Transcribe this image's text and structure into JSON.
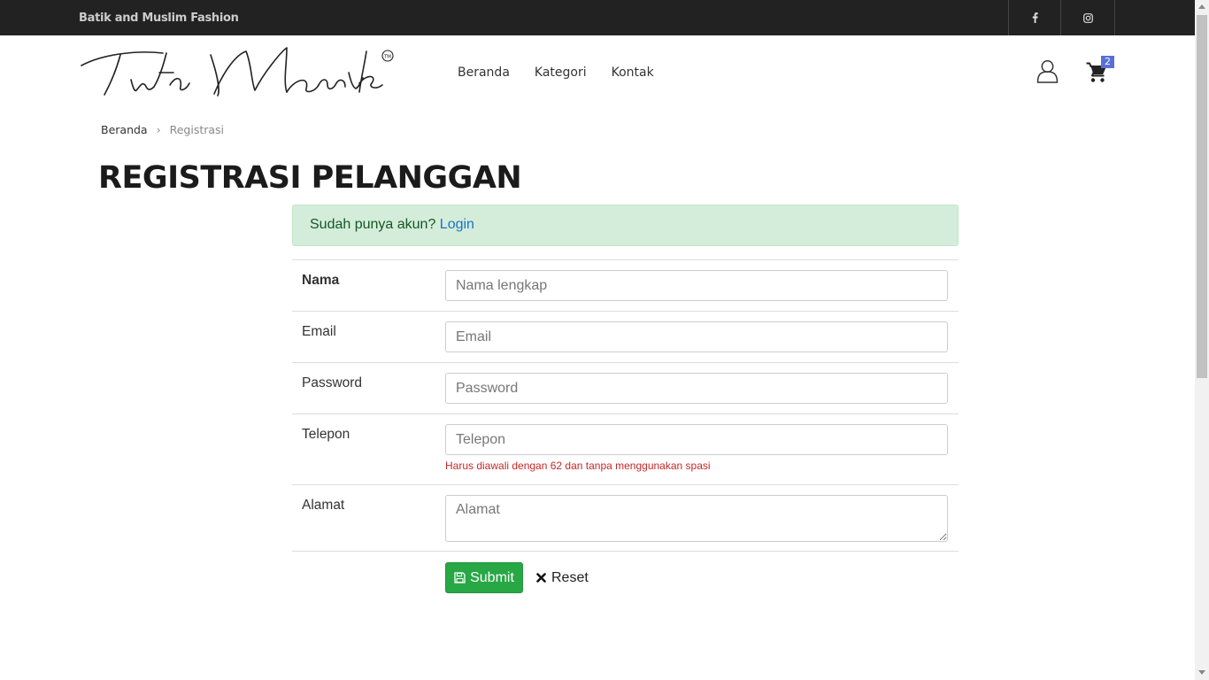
{
  "topbar": {
    "tagline": "Batik and Muslim Fashion"
  },
  "social": {
    "facebook_icon": "facebook-icon",
    "instagram_icon": "instagram-icon"
  },
  "header": {
    "logo_text": "Tirta Manik",
    "logo_mark": "TM",
    "nav": [
      "Beranda",
      "Kategori",
      "Kontak"
    ],
    "cart_count": "2"
  },
  "breadcrumb": {
    "home": "Beranda",
    "current": "Registrasi"
  },
  "page": {
    "title": "REGISTRASI PELANGGAN"
  },
  "alert": {
    "text": "Sudah punya akun? ",
    "link": "Login"
  },
  "form": {
    "nama": {
      "label": "Nama",
      "placeholder": "Nama lengkap"
    },
    "email": {
      "label": "Email",
      "placeholder": "Email"
    },
    "password": {
      "label": "Password",
      "placeholder": "Password"
    },
    "telepon": {
      "label": "Telepon",
      "placeholder": "Telepon",
      "hint": "Harus diawali dengan 62 dan tanpa menggunakan spasi"
    },
    "alamat": {
      "label": "Alamat",
      "placeholder": "Alamat"
    },
    "submit_label": "Submit",
    "reset_label": "Reset"
  },
  "colors": {
    "topbar": "#222222",
    "submit": "#28a745",
    "alert_bg": "#d4edda",
    "badge": "#5a6fd6"
  }
}
